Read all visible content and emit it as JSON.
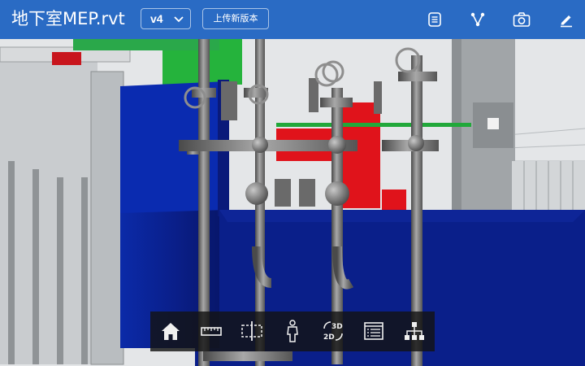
{
  "header": {
    "title": "地下室MEP.rvt",
    "version_label": "v4",
    "upload_label": "上传新版本",
    "colors": {
      "header_bg": "#2a6bc4"
    },
    "actions": [
      "list-icon",
      "graph-icon",
      "camera-icon",
      "edit-icon"
    ]
  },
  "viewer": {
    "description_colors": {
      "equipment_blue": "#0a1f8a",
      "red_element": "#e0131b",
      "green_element": "#25b33c",
      "pipe_gray": "#7c7c7c"
    }
  },
  "toolbar": {
    "tools": [
      "home-icon",
      "measure-icon",
      "section-icon",
      "first-person-icon",
      "3d-2d-toggle-icon",
      "properties-icon",
      "model-tree-icon"
    ],
    "label_3d": "3D",
    "label_2d": "2D"
  }
}
